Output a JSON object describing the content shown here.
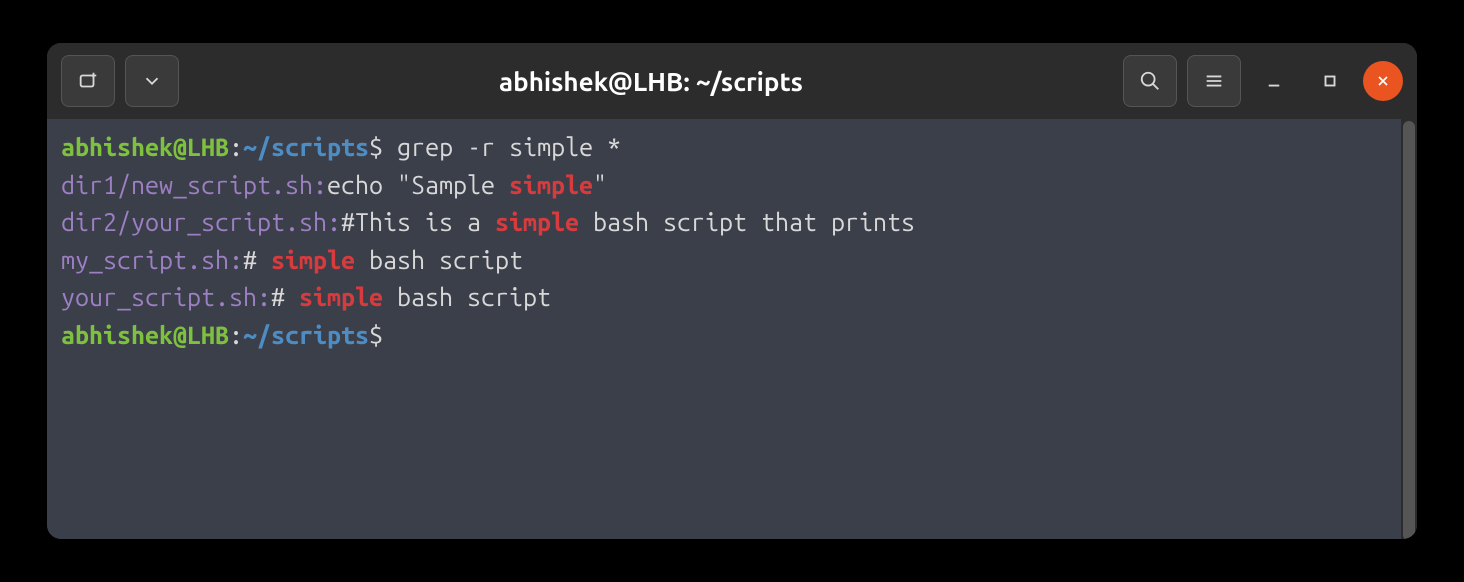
{
  "titlebar": {
    "title": "abhishek@LHB: ~/scripts"
  },
  "prompt": {
    "user_host": "abhishek@LHB",
    "separator": ":",
    "path": "~/scripts",
    "symbol": "$"
  },
  "lines": {
    "l1_cmd": " grep -r simple *",
    "l2_file": "dir1/new_script.sh:",
    "l2_text1": "echo \"Sample ",
    "l2_match": "simple",
    "l2_text2": "\"",
    "l3_file": "dir2/your_script.sh:",
    "l3_text1": "#This is a ",
    "l3_match": "simple",
    "l3_text2": " bash script that prints",
    "l4_file": "my_script.sh:",
    "l4_text1": "# ",
    "l4_match": "simple",
    "l4_text2": " bash script",
    "l5_file": "your_script.sh:",
    "l5_text1": "# ",
    "l5_match": "simple",
    "l5_text2": " bash script"
  },
  "colors": {
    "user": "#7ec13e",
    "path": "#4d8dc4",
    "file": "#9d7fc3",
    "match": "#d73b3e",
    "text": "#d8d8d8",
    "window_bg": "#3b3f4a",
    "titlebar_bg": "#2c2c2c",
    "close_btn": "#e95420"
  }
}
